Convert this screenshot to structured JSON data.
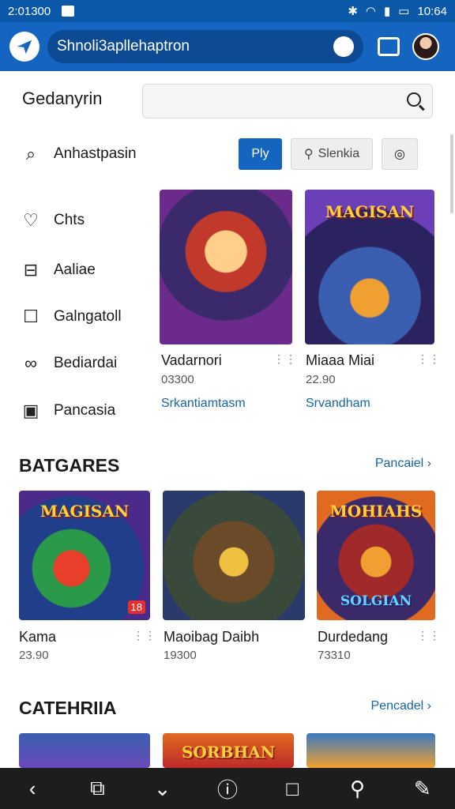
{
  "status": {
    "left_text": "2:01300",
    "time": "10:64"
  },
  "appbar": {
    "search_text": "Shnoli3apllehaptron"
  },
  "main": {
    "title": "Gedanyrin",
    "search_placeholder": ""
  },
  "filter": {
    "label": "Anhastpasin",
    "btn_primary": "Ply",
    "btn_secondary": "Slenkia"
  },
  "sidebar": {
    "items": [
      {
        "label": "Chts",
        "icon": "heart-icon"
      },
      {
        "label": "Aaliae",
        "icon": "bag-icon"
      },
      {
        "label": "Galngatoll",
        "icon": "edit-icon"
      },
      {
        "label": "Bediardai",
        "icon": "link-icon"
      },
      {
        "label": "Pancasia",
        "icon": "square-icon"
      }
    ]
  },
  "featured": [
    {
      "title": "Vadarnori",
      "price": "03300",
      "link": "Srkantiamtasm",
      "banner": ""
    },
    {
      "title": "Miaaa Miai",
      "price": "22.90",
      "link": "Srvandham",
      "banner": "MAGISAN"
    }
  ],
  "section1": {
    "title": "BATGARES",
    "link": "Pancaiel",
    "cards": [
      {
        "title": "Kama",
        "price": "23.90",
        "banner": "MAGISAN",
        "badge": "18"
      },
      {
        "title": "Maoibag Daibh",
        "price": "19300",
        "banner": "",
        "badge": ""
      },
      {
        "title": "Durdedang",
        "price": "73310",
        "banner": "MOHIAHS",
        "banner2": "SOLGIAN"
      }
    ]
  },
  "section2": {
    "title": "CATEHRIIA",
    "link": "Pencadel",
    "cards": [
      {
        "banner": ""
      },
      {
        "banner": "SORBHAN"
      },
      {
        "banner": ""
      }
    ]
  },
  "colors": {
    "primary": "#1565c0",
    "statusbar": "#0b57a8",
    "link": "#1566a8",
    "navbar": "#1d1d1d"
  }
}
